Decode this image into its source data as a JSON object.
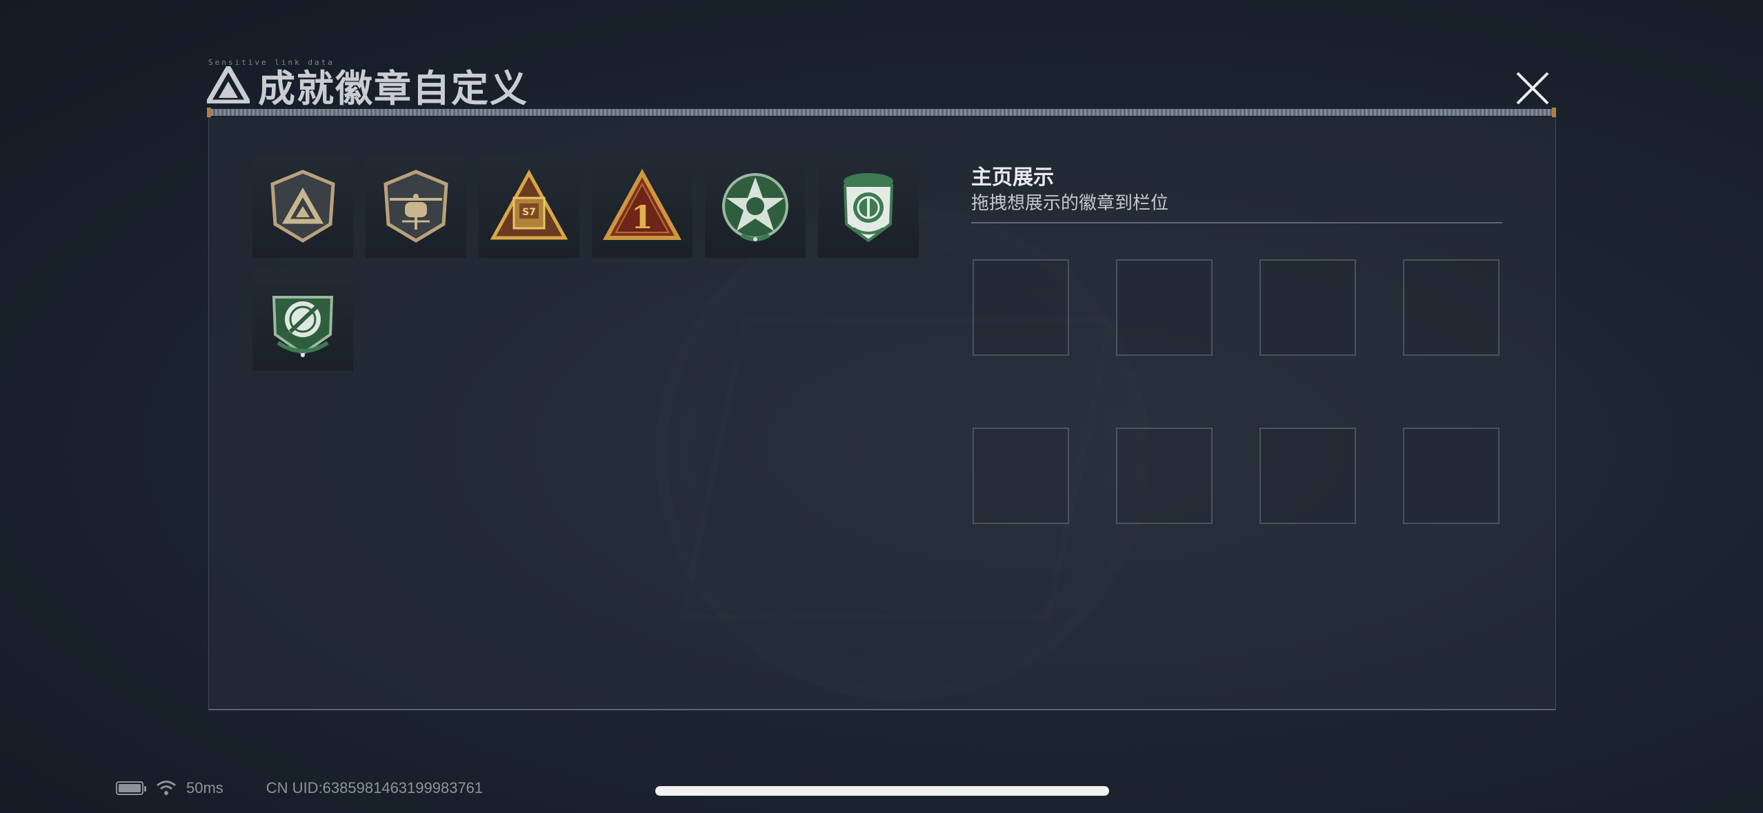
{
  "header": {
    "title": "成就徽章自定义",
    "tag": "Sensitive link data"
  },
  "display": {
    "title": "主页展示",
    "subtitle": "拖拽想展示的徽章到栏位"
  },
  "badges": [
    {
      "name": "triangle-shield-badge",
      "color": "#b9a27a"
    },
    {
      "name": "helicopter-badge",
      "color": "#b9a27a"
    },
    {
      "name": "s7-crate-badge",
      "color": "#d8a846"
    },
    {
      "name": "rank-1-triangle-badge",
      "color": "#c99840"
    },
    {
      "name": "skull-star-badge",
      "color": "#3f7a52"
    },
    {
      "name": "green-shield-emblem-badge",
      "color": "#3f7a52"
    },
    {
      "name": "crosshair-rocket-badge",
      "color": "#3f7a52"
    }
  ],
  "slots_count": 8,
  "status": {
    "latency": "50ms",
    "uid": "CN UID:6385981463199983761"
  }
}
